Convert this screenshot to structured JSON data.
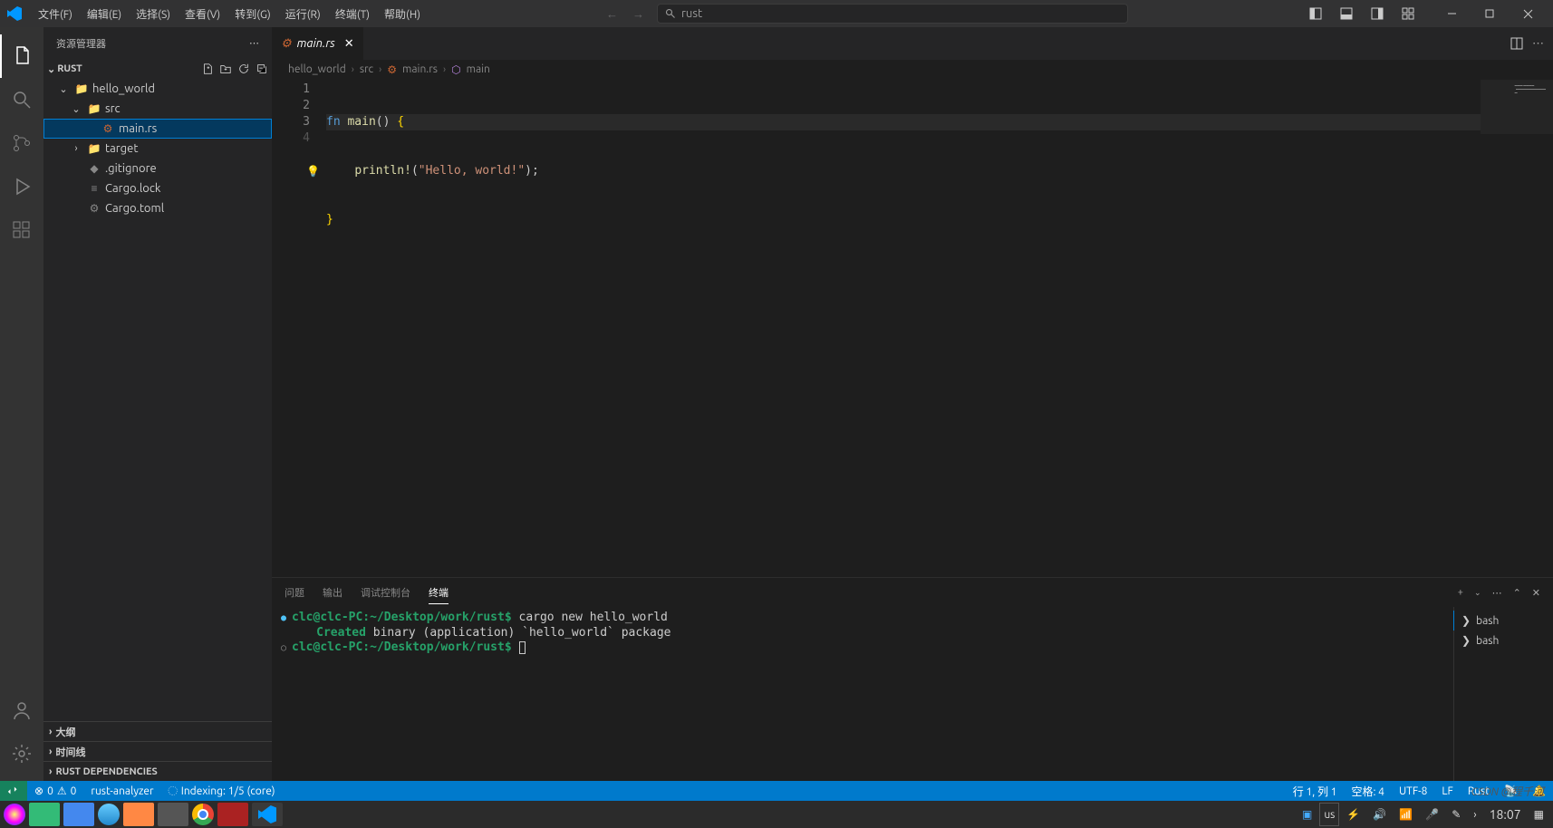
{
  "menus": [
    "文件(F)",
    "编辑(E)",
    "选择(S)",
    "查看(V)",
    "转到(G)",
    "运行(R)",
    "终端(T)",
    "帮助(H)"
  ],
  "search": {
    "text": "rust"
  },
  "sidebar": {
    "title": "资源管理器",
    "root": "RUST",
    "tree": {
      "project": "hello_world",
      "src": "src",
      "mainrs": "main.rs",
      "target": "target",
      "gitignore": ".gitignore",
      "cargolock": "Cargo.lock",
      "cargotoml": "Cargo.toml"
    },
    "collapsed": [
      "大纲",
      "时间线",
      "RUST DEPENDENCIES"
    ]
  },
  "tab": {
    "name": "main.rs"
  },
  "breadcrumbs": [
    "hello_world",
    "src",
    "main.rs",
    "main"
  ],
  "code": {
    "lines": [
      "1",
      "2",
      "3",
      "4"
    ]
  },
  "panel": {
    "tabs": [
      "问题",
      "输出",
      "调试控制台",
      "终端"
    ],
    "activeTab": 3,
    "prompt": "clc@clc-PC:~/Desktop/work/rust$",
    "cmd": "cargo new hello_world",
    "createdLabel": "Created",
    "createdMsg": "binary (application) `hello_world` package",
    "sessions": [
      "bash",
      "bash"
    ]
  },
  "status": {
    "errors": "0",
    "warnings": "0",
    "rustAnalyzer": "rust-analyzer",
    "indexing": "Indexing: 1/5 (core)",
    "lineCol": "行 1, 列 1",
    "spaces": "空格: 4",
    "encoding": "UTF-8",
    "eol": "LF",
    "lang": "Rust"
  },
  "taskbar": {
    "lang": "us",
    "time": "18:07"
  },
  "watermark": "CSDN @程千河"
}
